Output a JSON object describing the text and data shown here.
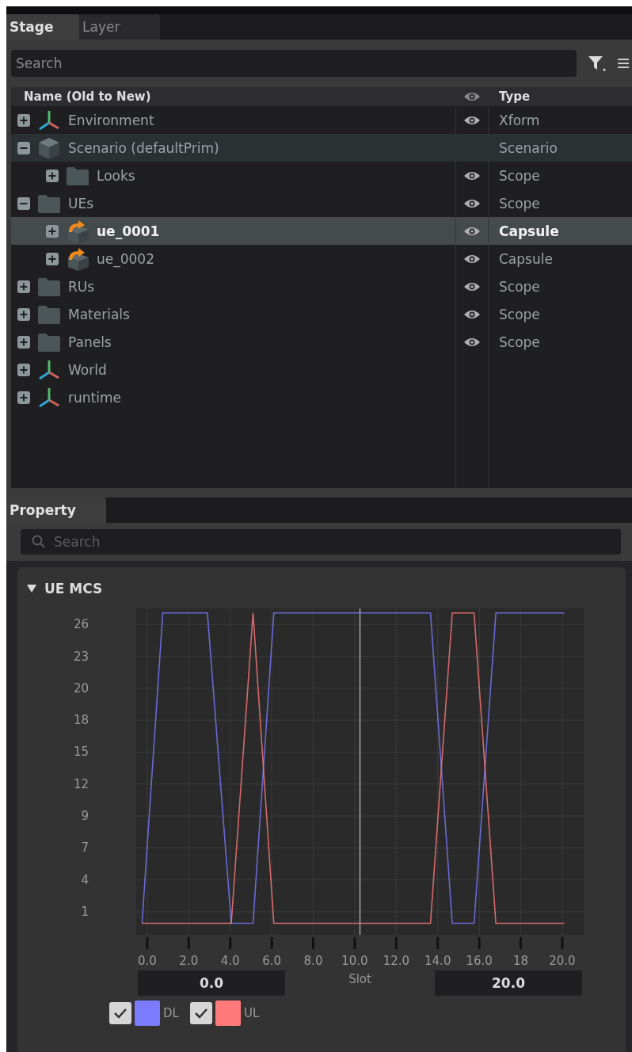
{
  "stage_tabs": [
    {
      "label": "Stage",
      "selected": true
    },
    {
      "label": "Layer",
      "selected": false
    }
  ],
  "stage_search": {
    "placeholder": "Search"
  },
  "tree": {
    "columns": {
      "name": "Name (Old to New)",
      "type": "Type"
    },
    "items": [
      {
        "name": "Environment",
        "kind": "xform",
        "expanded": false,
        "visible": true,
        "type": "Xform",
        "selected": false,
        "highlighted": false
      },
      {
        "name": "Scenario (defaultPrim)",
        "kind": "cube",
        "expanded": true,
        "visible": false,
        "type": "Scenario",
        "selected": false,
        "highlighted": true,
        "children": [
          {
            "name": "Looks",
            "kind": "folder",
            "expanded": false,
            "visible": true,
            "type": "Scope",
            "selected": false,
            "highlighted": false
          }
        ]
      },
      {
        "name": "UEs",
        "kind": "folder",
        "expanded": true,
        "visible": true,
        "type": "Scope",
        "selected": false,
        "highlighted": false,
        "children": [
          {
            "name": "ue_0001",
            "kind": "capsule",
            "expanded": false,
            "visible": true,
            "type": "Capsule",
            "selected": true,
            "highlighted": false
          },
          {
            "name": "ue_0002",
            "kind": "capsule",
            "expanded": false,
            "visible": true,
            "type": "Capsule",
            "selected": false,
            "highlighted": false
          }
        ]
      },
      {
        "name": "RUs",
        "kind": "folder",
        "expanded": false,
        "visible": true,
        "type": "Scope",
        "selected": false,
        "highlighted": false
      },
      {
        "name": "Materials",
        "kind": "folder",
        "expanded": false,
        "visible": true,
        "type": "Scope",
        "selected": false,
        "highlighted": false
      },
      {
        "name": "Panels",
        "kind": "folder",
        "expanded": false,
        "visible": true,
        "type": "Scope",
        "selected": false,
        "highlighted": false
      },
      {
        "name": "World",
        "kind": "xform",
        "expanded": false,
        "visible": false,
        "selected": false,
        "highlighted": false
      },
      {
        "name": "runtime",
        "kind": "xform",
        "expanded": false,
        "visible": false,
        "selected": false,
        "highlighted": false
      }
    ]
  },
  "property_tabs": [
    {
      "label": "Property",
      "selected": true
    }
  ],
  "property_search": {
    "placeholder": "Search"
  },
  "section": {
    "title": "UE MCS",
    "expanded": true,
    "chart_data": {
      "type": "line",
      "xlabel": "Slot",
      "grid": true,
      "x": [
        -0.25,
        0.75,
        2.9,
        4.05,
        5.1,
        6.1,
        13.65,
        14.7,
        15.75,
        16.8,
        20.1
      ],
      "series": [
        {
          "name": "DL",
          "color": "#7b7bff",
          "values": [
            0,
            27,
            27,
            0,
            0,
            27,
            27,
            0,
            0,
            27,
            27
          ]
        },
        {
          "name": "UL",
          "color": "#ff7b7b",
          "values": [
            0,
            0,
            0,
            0,
            27,
            0,
            0,
            27,
            27,
            0,
            0
          ]
        }
      ],
      "xlim": [
        -0.53,
        21.07
      ],
      "ylim": [
        -1,
        27.4
      ],
      "xticks": [
        {
          "value": 0,
          "label": "0.0"
        },
        {
          "value": 2,
          "label": "2.0"
        },
        {
          "value": 4,
          "label": "4.0"
        },
        {
          "value": 6,
          "label": "6.0"
        },
        {
          "value": 8,
          "label": "8.0"
        },
        {
          "value": 10,
          "label": "10.0"
        },
        {
          "value": 12,
          "label": "12.0"
        },
        {
          "value": 14,
          "label": "14.0"
        },
        {
          "value": 16,
          "label": "16.0"
        },
        {
          "value": 18,
          "label": "18"
        },
        {
          "value": 20,
          "label": "20.0"
        }
      ],
      "yticks": [
        {
          "value": 1,
          "label": "1"
        },
        {
          "value": 3.78,
          "label": "4"
        },
        {
          "value": 6.56,
          "label": "7"
        },
        {
          "value": 9.33,
          "label": "9"
        },
        {
          "value": 12.11,
          "label": "12"
        },
        {
          "value": 14.89,
          "label": "15"
        },
        {
          "value": 17.67,
          "label": "18"
        },
        {
          "value": 20.44,
          "label": "20"
        },
        {
          "value": 23.22,
          "label": "23"
        },
        {
          "value": 26,
          "label": "26"
        }
      ],
      "ref_lines": [
        {
          "axis": "x",
          "value": 10.25
        }
      ]
    },
    "range": {
      "min": "0.0",
      "max": "20.0"
    },
    "legend": [
      {
        "checked": true
      },
      {
        "checked": true
      }
    ]
  }
}
